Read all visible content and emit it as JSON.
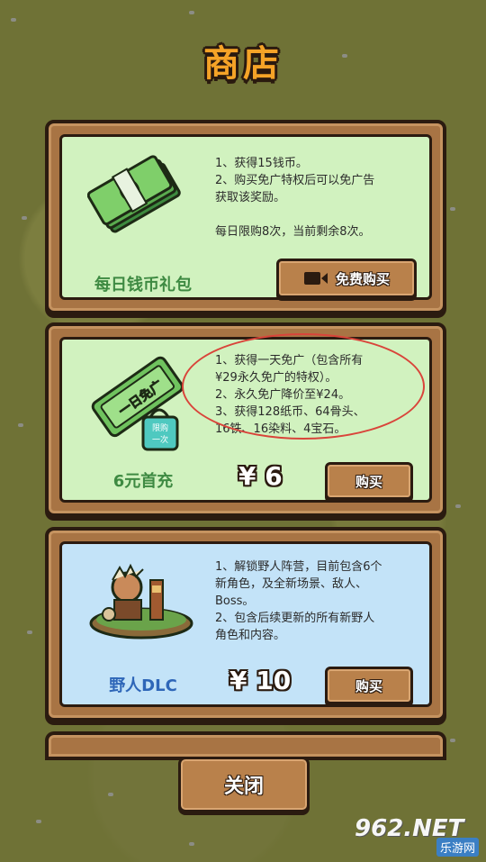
{
  "title": "商店",
  "packs": [
    {
      "name": "每日钱币礼包",
      "desc": "1、获得15钱币。\n2、购买免广特权后可以免广告\n获取该奖励。\n\n每日限购8次，当前剩余8次。",
      "button": "免费购买",
      "button_icon": "video-camera-icon",
      "name_color": "#3e8a42",
      "theme": "green"
    },
    {
      "name": "6元首充",
      "desc": "1、获得一天免广（包含所有\n¥29永久免广的特权）。\n2、永久免广降价至¥24。\n3、获得128纸币、64骨头、\n16铁、16染料、4宝石。",
      "price": "¥ 6",
      "button": "购买",
      "ticket_text": "一日免广",
      "bag_text": "限购\n一次",
      "name_color": "#3e8a42",
      "theme": "green"
    },
    {
      "name": "野人DLC",
      "desc": "1、解锁野人阵营，目前包含6个\n新角色，及全新场景、敌人、\nBoss。\n2、包含后续更新的所有新野人\n角色和内容。",
      "price": "¥ 10",
      "button": "购买",
      "name_color": "#2e66b8",
      "theme": "blue"
    }
  ],
  "close_button": "关闭",
  "watermark": {
    "main": "962.NET",
    "sub": "乐游网"
  },
  "colors": {
    "title": "#f5a327",
    "wood": "#a87444",
    "outline": "#2b1b10",
    "annotation": "#d9443a"
  }
}
